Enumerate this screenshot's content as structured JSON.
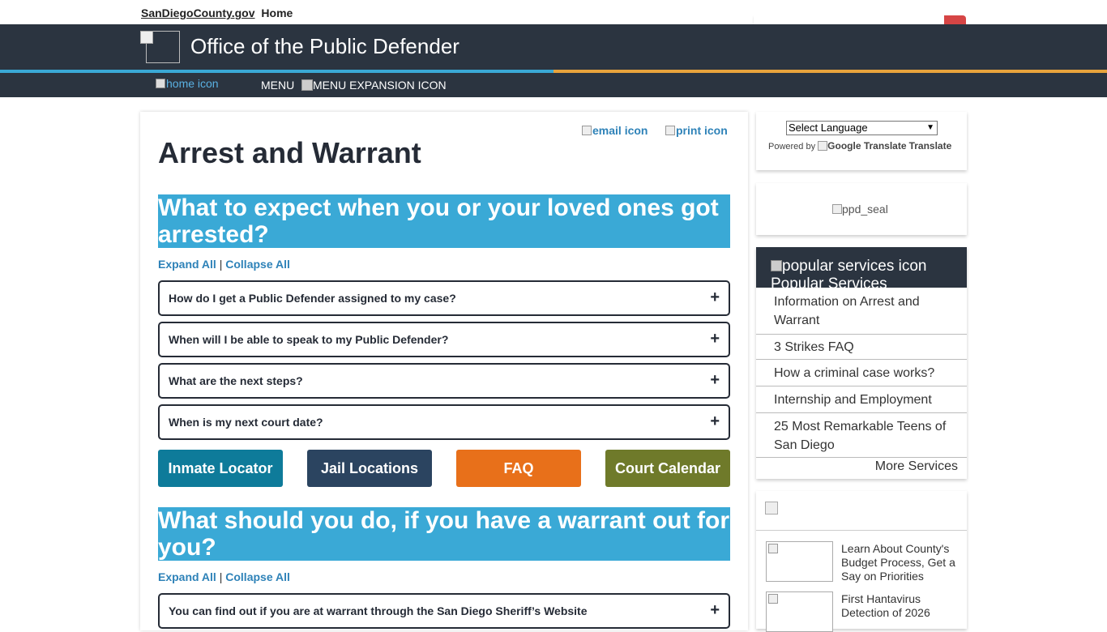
{
  "top": {
    "site_link": "SanDiegoCounty.gov",
    "home_link": "Home"
  },
  "header": {
    "title": "Office of the Public Defender"
  },
  "nav": {
    "home_icon_alt": "home icon",
    "menu_label": "MENU",
    "menu_expansion_alt": "MENU EXPANSION ICON"
  },
  "page": {
    "email_icon_alt": "email icon",
    "print_icon_alt": "print icon",
    "title": "Arrest and Warrant",
    "expand_all": "Expand All",
    "collapse_all": "Collapse All",
    "separator": "|"
  },
  "section1": {
    "heading": "What to expect when you or your loved ones got arrested?",
    "questions": [
      "How do I get a Public Defender assigned to my case?",
      "When will I be able to speak to my Public Defender?",
      "What are the next steps?",
      "When is my next court date?"
    ]
  },
  "buttons": {
    "inmate_locator": "Inmate Locator",
    "jail_locations": "Jail Locations",
    "faq": "FAQ",
    "court_calendar": "Court Calendar"
  },
  "section2": {
    "heading": "What should you do, if you have a warrant out for you?",
    "questions": [
      "You can find out if you are at warrant through the San Diego Sheriff’s Website"
    ]
  },
  "accordion_toggle": "+",
  "sidebar": {
    "language_select": "Select Language",
    "powered_by": "Powered by",
    "google_translate_alt": "Google Translate",
    "translate_label": "Translate",
    "seal_alt": "ppd_seal",
    "popular_icon_alt": "popular services icon",
    "popular_title": "Popular Services",
    "popular_items": [
      "Information on Arrest and Warrant",
      "3 Strikes FAQ",
      "How a criminal case works?",
      "Internship and Employment",
      "25 Most Remarkable Teens of San Diego"
    ],
    "more_services": "More Services",
    "news": [
      "Learn About County's Budget Process, Get a Say on Priorities",
      "First Hantavirus Detection of 2026"
    ]
  },
  "colors": {
    "header_bg": "#2b3440",
    "section_heading_bg": "#3aa9d6",
    "link": "#2e82b8",
    "inmate_locator": "#0e7b9a",
    "jail_locations": "#2b4460",
    "faq": "#e8701a",
    "court_calendar": "#6f7a2a",
    "search_button": "#d64545"
  }
}
